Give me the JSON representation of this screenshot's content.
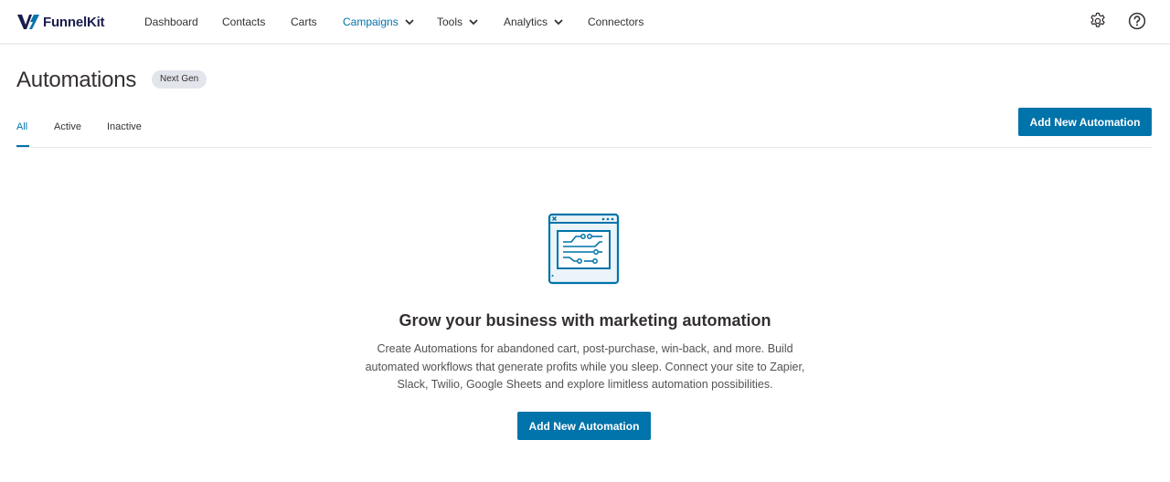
{
  "brand": {
    "name": "FunnelKit",
    "accent": "#0073aa",
    "logo_color": "#1a1d4e"
  },
  "nav": {
    "items": [
      {
        "label": "Dashboard"
      },
      {
        "label": "Contacts"
      },
      {
        "label": "Carts"
      },
      {
        "label": "Campaigns",
        "active": true,
        "has_dropdown": true
      },
      {
        "label": "Tools",
        "has_dropdown": true
      },
      {
        "label": "Analytics",
        "has_dropdown": true
      },
      {
        "label": "Connectors"
      }
    ],
    "icons": [
      "gear-icon",
      "help-icon"
    ]
  },
  "page": {
    "title": "Automations",
    "badge": "Next Gen",
    "tabs": [
      {
        "label": "All",
        "active": true
      },
      {
        "label": "Active"
      },
      {
        "label": "Inactive"
      }
    ],
    "add_button_label": "Add New Automation"
  },
  "empty_state": {
    "icon": "automation-workflow-icon",
    "heading": "Grow your business with marketing automation",
    "description_lines": [
      "Create Automations for abandoned cart, post-purchase, win-back, and more. Build",
      "automated workflows that generate profits while you sleep. Connect your site to Zapier,",
      "Slack, Twilio, Google Sheets and explore limitless automation possibilities."
    ],
    "button_label": "Add New Automation"
  }
}
